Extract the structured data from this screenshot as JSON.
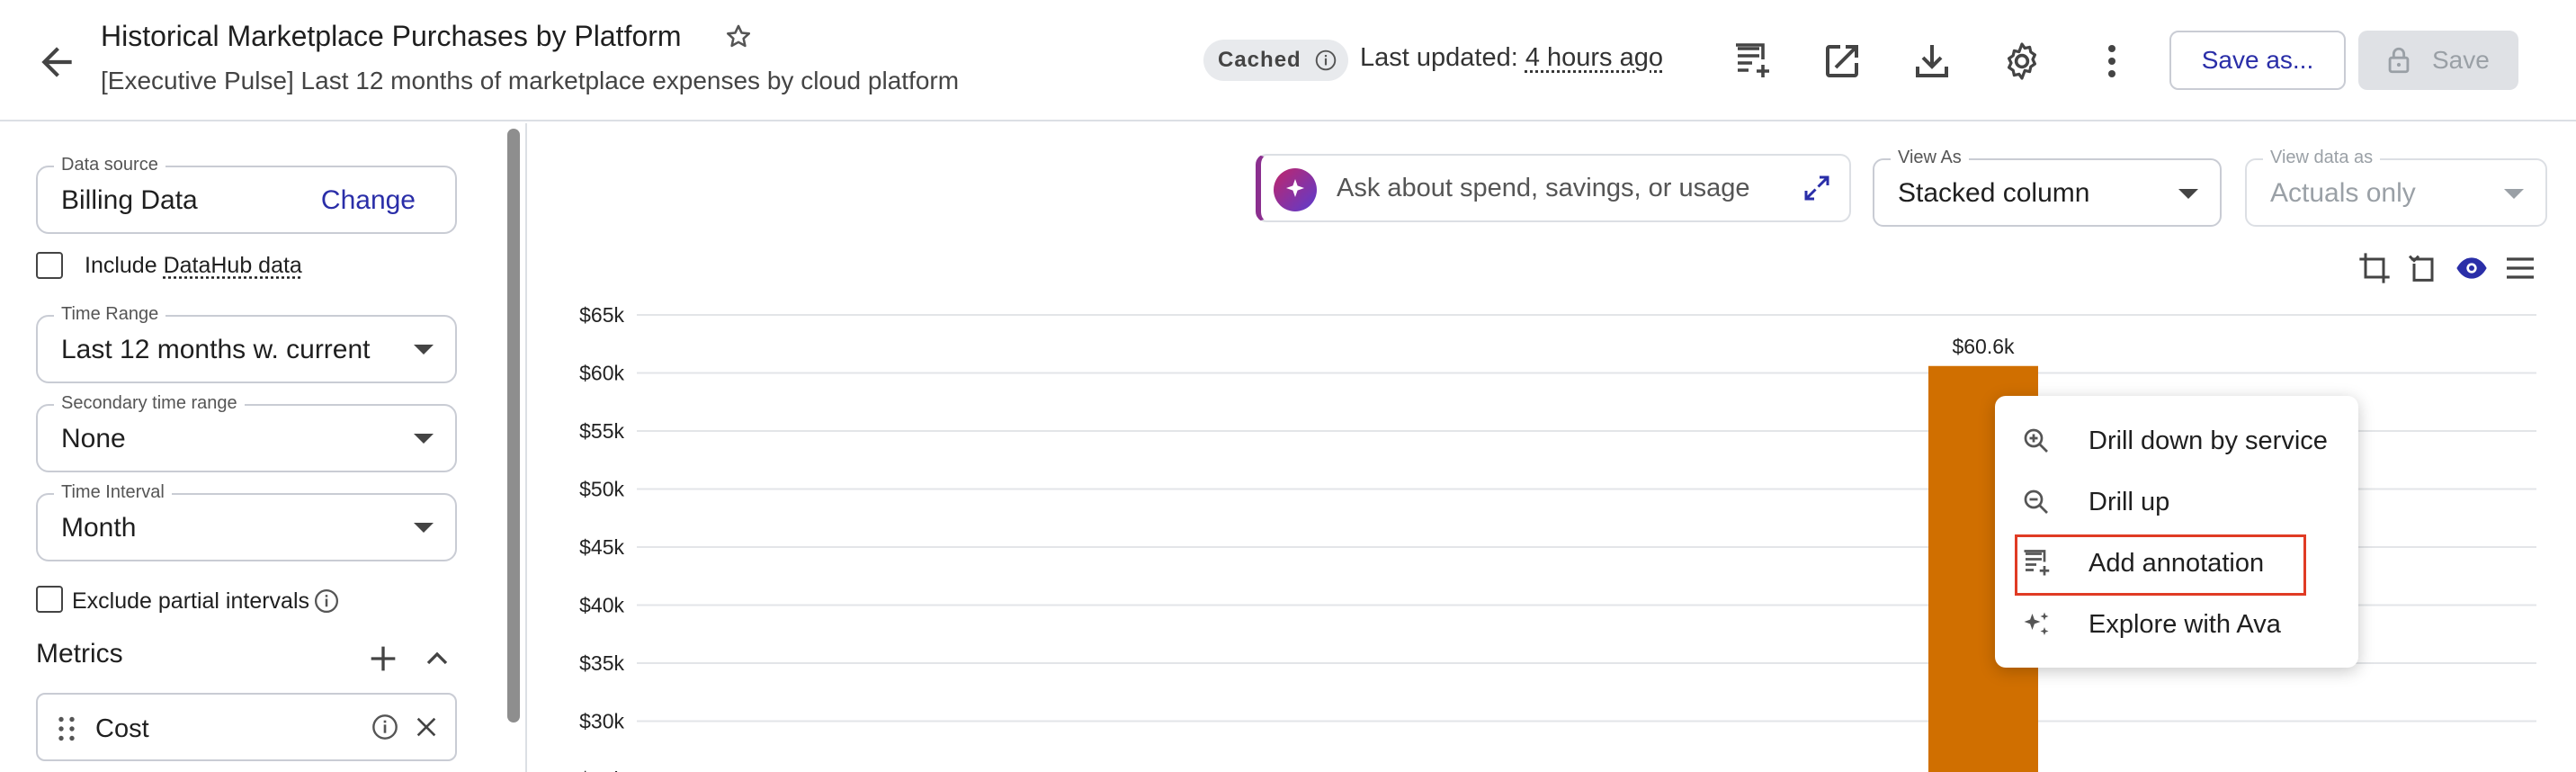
{
  "header": {
    "title": "Historical Marketplace Purchases by Platform",
    "subtitle": "[Executive Pulse] Last 12 months of marketplace expenses by cloud platform",
    "cached_badge": "Cached",
    "last_updated_label": "Last updated:",
    "last_updated_value": "4 hours ago",
    "save_as_label": "Save as...",
    "save_label": "Save",
    "icons": [
      "back-arrow-icon",
      "star-icon",
      "info-icon",
      "add-note-icon",
      "open-external-icon",
      "download-icon",
      "gear-icon",
      "more-vertical-icon",
      "lock-icon"
    ]
  },
  "sidebar": {
    "data_source": {
      "label": "Data source",
      "value": "Billing Data",
      "action": "Change"
    },
    "include_datahub": {
      "prefix": "Include ",
      "link": "DataHub data",
      "checked": false
    },
    "time_range": {
      "label": "Time Range",
      "value": "Last 12 months w. current"
    },
    "secondary_time_range": {
      "label": "Secondary time range",
      "value": "None"
    },
    "time_interval": {
      "label": "Time Interval",
      "value": "Month"
    },
    "exclude_partial": {
      "label": "Exclude partial intervals",
      "checked": false
    },
    "metrics": {
      "title": "Metrics",
      "items": [
        {
          "label": "Cost"
        }
      ]
    }
  },
  "toolbar": {
    "ask_placeholder": "Ask about spend, savings, or usage",
    "view_as": {
      "label": "View As",
      "value": "Stacked column"
    },
    "view_data_as": {
      "label": "View data as",
      "value": "Actuals only",
      "disabled": true
    }
  },
  "chart_data": {
    "type": "bar",
    "stacked": true,
    "y_ticks": [
      "$65k",
      "$60k",
      "$55k",
      "$50k",
      "$45k",
      "$40k",
      "$35k",
      "$30k"
    ],
    "ylim": [
      25000,
      65000
    ],
    "bars": [
      {
        "value": 60600,
        "label": "$60.6k",
        "color": "#d06f00"
      }
    ],
    "grid": true
  },
  "context_menu": {
    "items": [
      {
        "label": "Drill down by service",
        "icon": "zoom-in-icon"
      },
      {
        "label": "Drill up",
        "icon": "zoom-out-icon"
      },
      {
        "label": "Add annotation",
        "icon": "add-note-icon",
        "highlighted": true
      },
      {
        "label": "Explore with Ava",
        "icon": "sparkles-icon"
      }
    ],
    "highlight_color": "#e03b24"
  }
}
